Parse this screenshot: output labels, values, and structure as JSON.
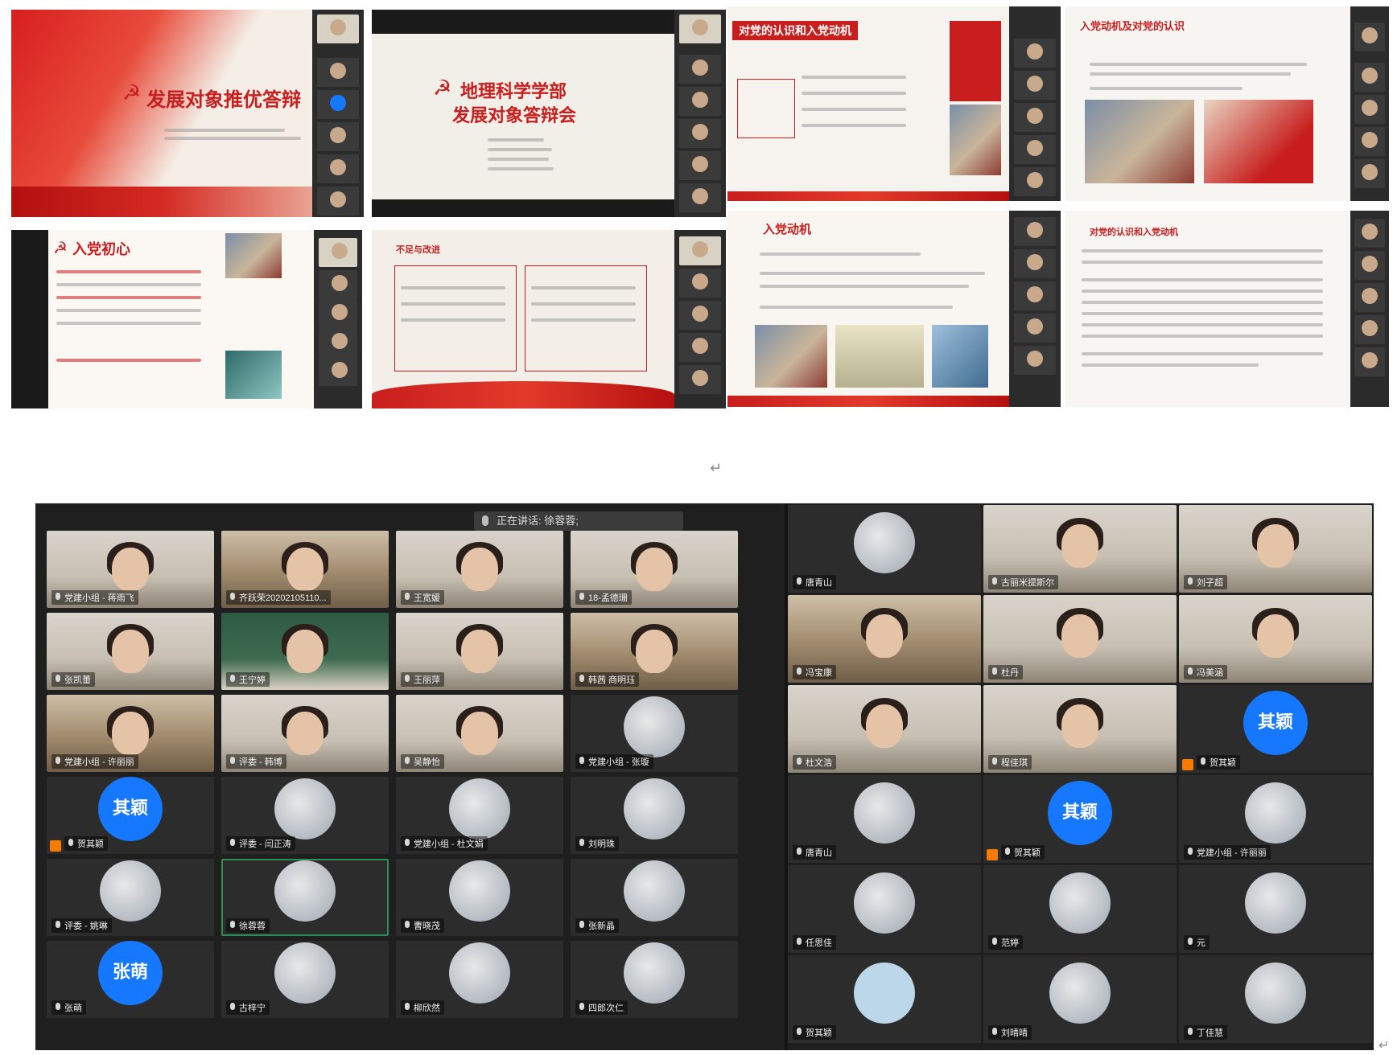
{
  "screenshots": [
    {
      "title": "发展对象推优答辩"
    },
    {
      "title_line1": "地理科学学部",
      "title_line2": "发展对象答辩会"
    },
    {
      "title": "对党的认识和入党动机"
    },
    {
      "title": "入党动机及对党的认识"
    },
    {
      "title": "入党初心"
    },
    {
      "title": "不足与改进"
    },
    {
      "title": "入党动机"
    },
    {
      "title": "对党的认识和入党动机"
    }
  ],
  "meeting": {
    "speaker_label": "正在讲话: 徐蓉蓉;",
    "left_tiles": [
      {
        "name": "党建小组 - 蒋雨飞",
        "kind": "video"
      },
      {
        "name": "齐跃荣20202105110...",
        "kind": "shelf"
      },
      {
        "name": "王宽媛",
        "kind": "video"
      },
      {
        "name": "18-孟德珊",
        "kind": "video"
      },
      {
        "name": "张凯蕾",
        "kind": "video"
      },
      {
        "name": "王宁婷",
        "kind": "green"
      },
      {
        "name": "王丽萍",
        "kind": "video"
      },
      {
        "name": "韩茜 商明珏",
        "kind": "shelf"
      },
      {
        "name": "党建小组 - 许丽丽",
        "kind": "shelf"
      },
      {
        "name": "评委 - 韩博",
        "kind": "video"
      },
      {
        "name": "吴静怡",
        "kind": "video"
      },
      {
        "name": "党建小组 - 张璇",
        "kind": "avatar"
      },
      {
        "name": "贺其颖",
        "kind": "blue",
        "avatar_text": "其颖",
        "host": true
      },
      {
        "name": "评委 - 闫正涛",
        "kind": "avatar"
      },
      {
        "name": "党建小组 - 杜文娟",
        "kind": "avatar"
      },
      {
        "name": "刘明珠",
        "kind": "avatar"
      },
      {
        "name": "评委 - 姚琳",
        "kind": "avatar"
      },
      {
        "name": "徐蓉蓉",
        "kind": "avatar",
        "active": true
      },
      {
        "name": "曹晓茂",
        "kind": "avatar"
      },
      {
        "name": "张新晶",
        "kind": "avatar"
      },
      {
        "name": "张萌",
        "kind": "blue",
        "avatar_text": "张萌"
      },
      {
        "name": "古梓宁",
        "kind": "avatar"
      },
      {
        "name": "柳欣然",
        "kind": "avatar"
      },
      {
        "name": "四郎次仁",
        "kind": "avatar"
      }
    ],
    "right_tiles": [
      {
        "name": "唐青山",
        "kind": "avatar"
      },
      {
        "name": "古丽米提斯尔",
        "kind": "video"
      },
      {
        "name": "刘子超",
        "kind": "video"
      },
      {
        "name": "冯宝康",
        "kind": "shelf"
      },
      {
        "name": "杜丹",
        "kind": "video"
      },
      {
        "name": "冯美涵",
        "kind": "video"
      },
      {
        "name": "杜文浩",
        "kind": "video"
      },
      {
        "name": "程佳琪",
        "kind": "video"
      },
      {
        "name": "贺其颖",
        "kind": "blue",
        "avatar_text": "其颖",
        "host": true
      },
      {
        "name": "唐青山",
        "kind": "avatar"
      },
      {
        "name": "贺其颖",
        "kind": "blue",
        "avatar_text": "其颖",
        "host": true
      },
      {
        "name": "党建小组 - 许丽丽",
        "kind": "avatar"
      },
      {
        "name": "任思佳",
        "kind": "avatar"
      },
      {
        "name": "范婷",
        "kind": "avatar"
      },
      {
        "name": "元",
        "kind": "avatar"
      },
      {
        "name": "贺其颖",
        "kind": "plain"
      },
      {
        "name": "刘晴晴",
        "kind": "avatar"
      },
      {
        "name": "丁佳慧",
        "kind": "avatar"
      }
    ]
  },
  "paragraph_mark": "↵"
}
